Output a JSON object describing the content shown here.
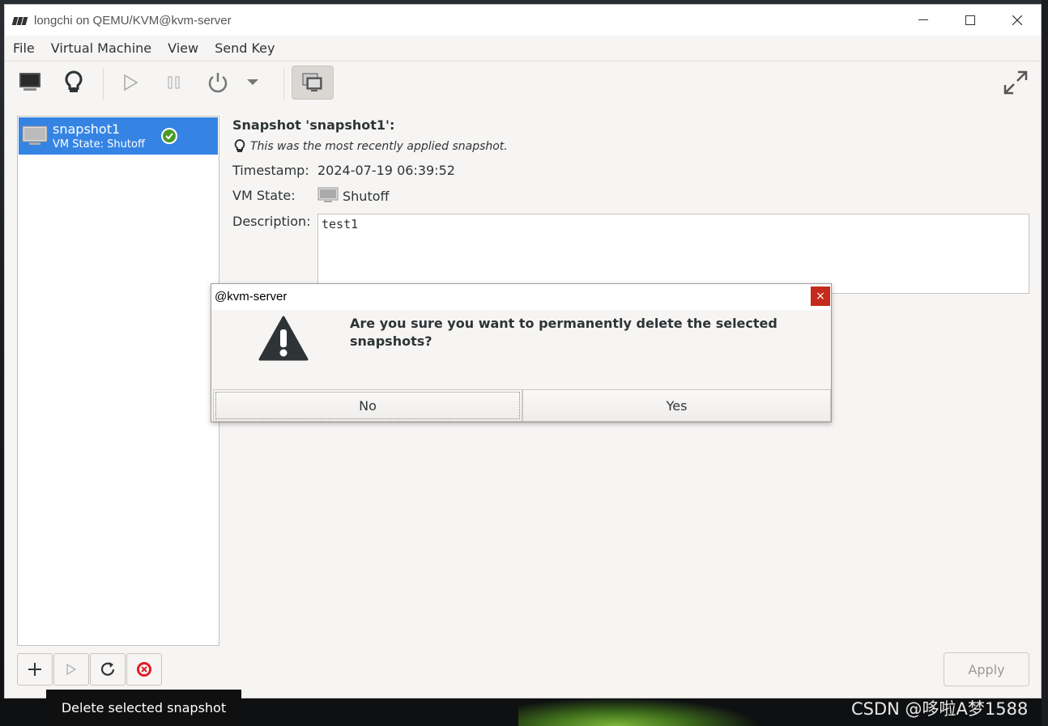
{
  "window": {
    "title": "longchi on QEMU/KVM@kvm-server",
    "controls": {
      "minimize": "—",
      "maximize": "☐",
      "close": "✕"
    }
  },
  "menubar": {
    "items": [
      "File",
      "Virtual Machine",
      "View",
      "Send Key"
    ]
  },
  "toolbar": {
    "buttons": [
      "console-icon",
      "lightbulb-icon",
      "run-icon",
      "pause-icon",
      "power-icon",
      "dropdown-icon",
      "snapshots-icon",
      "fullscreen-icon"
    ]
  },
  "snapshots": [
    {
      "name": "snapshot1",
      "state": "VM State: Shutoff",
      "current": true
    }
  ],
  "details": {
    "title": "Snapshot 'snapshot1':",
    "note": "This was the most recently applied snapshot.",
    "timestamp_label": "Timestamp:",
    "timestamp_value": "2024-07-19 06:39:52",
    "vmstate_label": "VM State:",
    "vmstate_value": "Shutoff",
    "description_label": "Description:",
    "description_value": "test1"
  },
  "bottom": {
    "buttons": [
      "add-icon",
      "run-icon",
      "refresh-icon",
      "delete-icon"
    ],
    "apply_label": "Apply"
  },
  "tooltip": "Delete selected snapshot",
  "dialog": {
    "title": "@kvm-server",
    "close": "×",
    "message": "Are you sure you want to permanently delete the selected snapshots?",
    "no_label": "No",
    "yes_label": "Yes"
  },
  "watermark": "CSDN @哆啦A梦1588",
  "colors": {
    "selection": "#3584e4",
    "close_red": "#c42b1c",
    "check_green": "#4c9a2a"
  }
}
